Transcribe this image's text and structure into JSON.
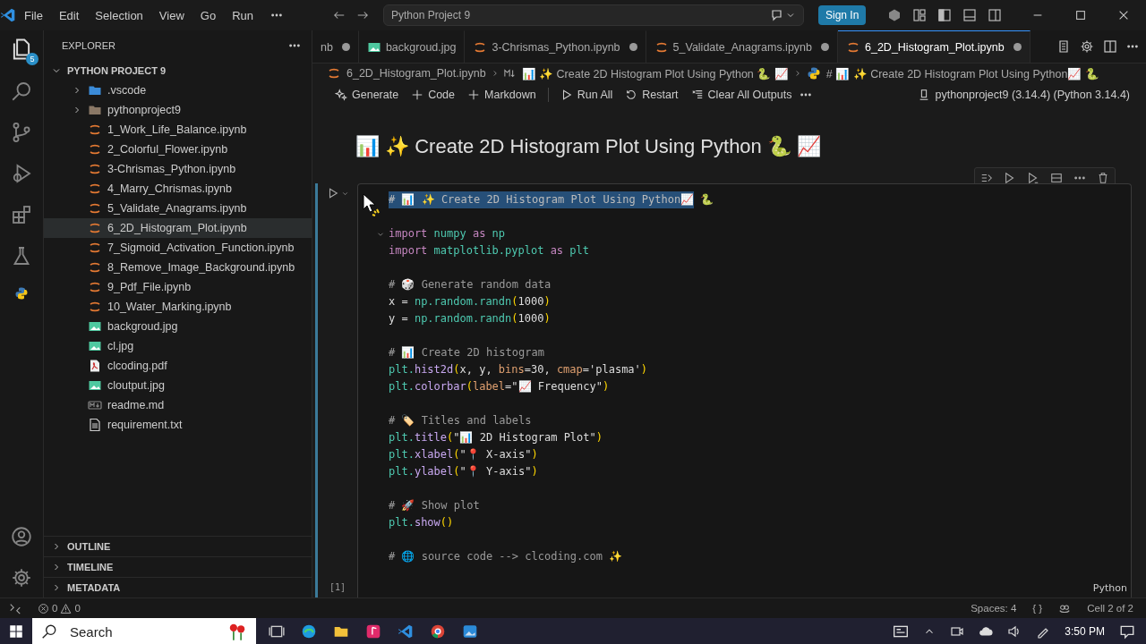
{
  "titlebar": {
    "menu": [
      "File",
      "Edit",
      "Selection",
      "View",
      "Go",
      "Run"
    ],
    "command_center": "Python Project 9",
    "sign_in": "Sign In"
  },
  "activity_bar": {
    "badge": "5"
  },
  "explorer": {
    "title": "EXPLORER",
    "root": {
      "label": "PYTHON PROJECT 9",
      "expanded": true
    },
    "items": [
      {
        "label": ".vscode",
        "kind": "folder",
        "expanded": false,
        "selected": false
      },
      {
        "label": "pythonproject9",
        "kind": "folder",
        "expanded": false,
        "selected": false
      },
      {
        "label": "1_Work_Life_Balance.ipynb",
        "kind": "notebook",
        "selected": false
      },
      {
        "label": "2_Colorful_Flower.ipynb",
        "kind": "notebook",
        "selected": false
      },
      {
        "label": "3-Chrismas_Python.ipynb",
        "kind": "notebook",
        "selected": false
      },
      {
        "label": "4_Marry_Chrismas.ipynb",
        "kind": "notebook",
        "selected": false
      },
      {
        "label": "5_Validate_Anagrams.ipynb",
        "kind": "notebook",
        "selected": false
      },
      {
        "label": "6_2D_Histogram_Plot.ipynb",
        "kind": "notebook",
        "selected": true
      },
      {
        "label": "7_Sigmoid_Activation_Function.ipynb",
        "kind": "notebook",
        "selected": false
      },
      {
        "label": "8_Remove_Image_Background.ipynb",
        "kind": "notebook",
        "selected": false
      },
      {
        "label": "9_Pdf_File.ipynb",
        "kind": "notebook",
        "selected": false
      },
      {
        "label": "10_Water_Marking.ipynb",
        "kind": "notebook",
        "selected": false
      },
      {
        "label": "backgroud.jpg",
        "kind": "image",
        "selected": false
      },
      {
        "label": "cl.jpg",
        "kind": "image",
        "selected": false
      },
      {
        "label": "clcoding.pdf",
        "kind": "pdf",
        "selected": false
      },
      {
        "label": "cloutput.jpg",
        "kind": "image",
        "selected": false
      },
      {
        "label": "readme.md",
        "kind": "markdown",
        "selected": false
      },
      {
        "label": "requirement.txt",
        "kind": "text",
        "selected": false
      }
    ],
    "sections": [
      {
        "label": "OUTLINE",
        "expanded": false
      },
      {
        "label": "TIMELINE",
        "expanded": false
      },
      {
        "label": "METADATA",
        "expanded": false
      }
    ]
  },
  "tabs": [
    {
      "label": "nb",
      "dirty": true,
      "selected": false
    },
    {
      "label": "backgroud.jpg",
      "kind": "image",
      "dirty": false,
      "selected": false
    },
    {
      "label": "3-Chrismas_Python.ipynb",
      "kind": "notebook",
      "dirty": true,
      "selected": false
    },
    {
      "label": "5_Validate_Anagrams.ipynb",
      "kind": "notebook",
      "dirty": true,
      "selected": false
    },
    {
      "label": "6_2D_Histogram_Plot.ipynb",
      "kind": "notebook",
      "dirty": true,
      "selected": true
    }
  ],
  "breadcrumb": [
    {
      "label": "6_2D_Histogram_Plot.ipynb",
      "kind": "notebook"
    },
    {
      "label": "📊 ✨ Create 2D Histogram Plot Using Python 🐍 📈",
      "kind": "markdown"
    },
    {
      "label": "# 📊 ✨ Create 2D Histogram Plot Using Python📈 🐍",
      "kind": "python"
    }
  ],
  "notebook_toolbar": {
    "actions": [
      {
        "label": "Generate",
        "kind": "sparkle"
      },
      {
        "label": "Code",
        "kind": "plus"
      },
      {
        "label": "Markdown",
        "kind": "plus"
      },
      {
        "label": "Run All",
        "kind": "play"
      },
      {
        "label": "Restart",
        "kind": "restart"
      },
      {
        "label": "Clear All Outputs",
        "kind": "clear"
      }
    ],
    "kernel": "pythonproject9 (3.14.4) (Python 3.14.4)"
  },
  "markdown_cell": {
    "heading": "📊 ✨ Create 2D Histogram Plot Using Python 🐍 📈"
  },
  "code_cell": {
    "execution_count": "[1]",
    "language": "Python",
    "blocks": [
      [
        [
          {
            "text": "# 📊 ✨ Create 2D Histogram Plot Using Python📈",
            "kind": "selected"
          },
          {
            "text": " 🐍",
            "kind": "comment"
          }
        ]
      ],
      [
        [
          {
            "text": "import",
            "kind": "keyword"
          },
          {
            "text": " numpy ",
            "kind": "module"
          },
          {
            "text": "as",
            "kind": "keyword"
          },
          {
            "text": " np",
            "kind": "module"
          }
        ],
        [
          {
            "text": "import",
            "kind": "keyword"
          },
          {
            "text": " matplotlib.pyplot ",
            "kind": "module"
          },
          {
            "text": "as",
            "kind": "keyword"
          },
          {
            "text": " plt",
            "kind": "module"
          }
        ]
      ],
      [
        [
          {
            "text": "# 🎲 Generate random data",
            "kind": "comment"
          }
        ],
        [
          {
            "text": "x = ",
            "kind": "plain"
          },
          {
            "text": "np.random.randn",
            "kind": "module"
          },
          {
            "text": "(",
            "kind": "bracket"
          },
          {
            "text": "1000",
            "kind": "plain"
          },
          {
            "text": ")",
            "kind": "bracket"
          }
        ],
        [
          {
            "text": "y = ",
            "kind": "plain"
          },
          {
            "text": "np.random.randn",
            "kind": "module"
          },
          {
            "text": "(",
            "kind": "bracket"
          },
          {
            "text": "1000",
            "kind": "plain"
          },
          {
            "text": ")",
            "kind": "bracket"
          }
        ]
      ],
      [
        [
          {
            "text": "# 📊 Create 2D histogram",
            "kind": "comment"
          }
        ],
        [
          {
            "text": "plt.",
            "kind": "module"
          },
          {
            "text": "hist2d",
            "kind": "function"
          },
          {
            "text": "(",
            "kind": "bracket"
          },
          {
            "text": "x, y, ",
            "kind": "plain"
          },
          {
            "text": "bins",
            "kind": "argument"
          },
          {
            "text": "=30, ",
            "kind": "plain"
          },
          {
            "text": "cmap",
            "kind": "argument"
          },
          {
            "text": "='plasma'",
            "kind": "plain"
          },
          {
            "text": ")",
            "kind": "bracket"
          }
        ],
        [
          {
            "text": "plt.",
            "kind": "module"
          },
          {
            "text": "colorbar",
            "kind": "function"
          },
          {
            "text": "(",
            "kind": "bracket"
          },
          {
            "text": "label",
            "kind": "argument"
          },
          {
            "text": "=\"📈 Frequency\"",
            "kind": "plain"
          },
          {
            "text": ")",
            "kind": "bracket"
          }
        ]
      ],
      [
        [
          {
            "text": "# 🏷️ Titles and labels",
            "kind": "comment"
          }
        ],
        [
          {
            "text": "plt.",
            "kind": "module"
          },
          {
            "text": "title",
            "kind": "function"
          },
          {
            "text": "(",
            "kind": "bracket"
          },
          {
            "text": "\"📊 2D Histogram Plot\"",
            "kind": "plain"
          },
          {
            "text": ")",
            "kind": "bracket"
          }
        ],
        [
          {
            "text": "plt.",
            "kind": "module"
          },
          {
            "text": "xlabel",
            "kind": "function"
          },
          {
            "text": "(",
            "kind": "bracket"
          },
          {
            "text": "\"📍 X-axis\"",
            "kind": "plain"
          },
          {
            "text": ")",
            "kind": "bracket"
          }
        ],
        [
          {
            "text": "plt.",
            "kind": "module"
          },
          {
            "text": "ylabel",
            "kind": "function"
          },
          {
            "text": "(",
            "kind": "bracket"
          },
          {
            "text": "\"📍 Y-axis\"",
            "kind": "plain"
          },
          {
            "text": ")",
            "kind": "bracket"
          }
        ]
      ],
      [
        [
          {
            "text": "# 🚀 Show plot",
            "kind": "comment"
          }
        ],
        [
          {
            "text": "plt.",
            "kind": "module"
          },
          {
            "text": "show",
            "kind": "function"
          },
          {
            "text": "()",
            "kind": "bracket"
          }
        ]
      ],
      [
        [
          {
            "text": "# 🌐 source code --> clcoding.com ✨",
            "kind": "comment"
          }
        ]
      ]
    ]
  },
  "status_bar": {
    "errors": "0",
    "warnings": "0",
    "indent": "Spaces: 4",
    "braces": "{ }",
    "cell": "Cell 2 of 2"
  },
  "taskbar": {
    "search_placeholder": "Search",
    "time": "3:50 PM"
  }
}
